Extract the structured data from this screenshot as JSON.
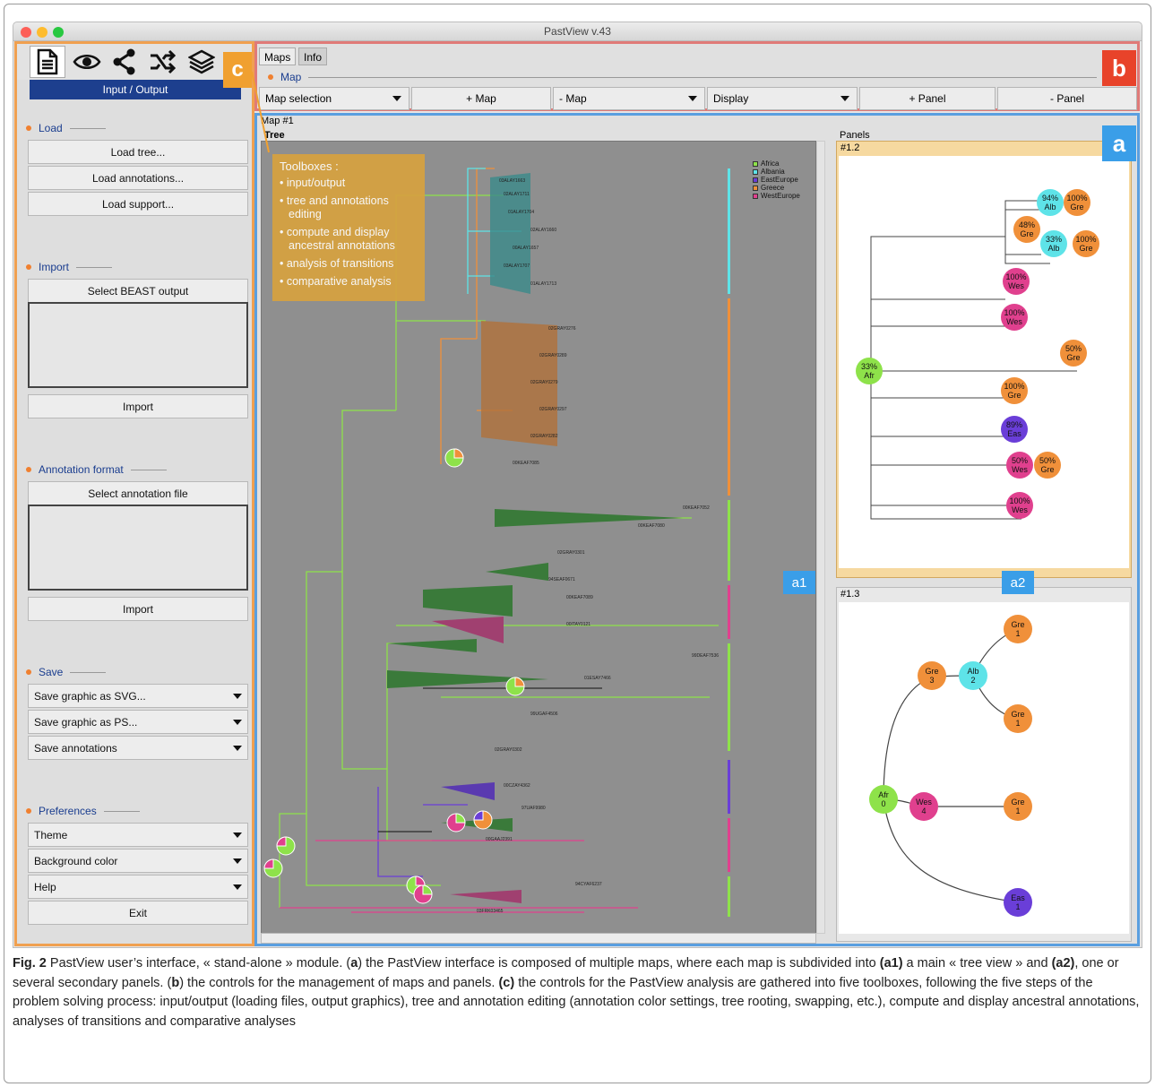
{
  "window": {
    "title": "PastView v.43"
  },
  "left_toolbox": {
    "header": "Input / Output",
    "icons": [
      "document-icon",
      "eye-icon",
      "share-icon",
      "shuffle-icon",
      "layers-icon"
    ],
    "load": {
      "title": "Load",
      "buttons": [
        "Load tree...",
        "Load annotations...",
        "Load support..."
      ]
    },
    "import": {
      "title": "Import",
      "label": "Select BEAST output",
      "button": "Import"
    },
    "annotation_format": {
      "title": "Annotation format",
      "label": "Select annotation file",
      "button": "Import"
    },
    "save": {
      "title": "Save",
      "items": [
        "Save graphic as SVG...",
        "Save graphic as PS...",
        "Save annotations"
      ]
    },
    "preferences": {
      "title": "Preferences",
      "items": [
        "Theme",
        "Background color",
        "Help"
      ],
      "exit": "Exit"
    }
  },
  "maps_toolbar": {
    "tabs": [
      "Maps",
      "Info"
    ],
    "section": "Map",
    "buttons": [
      "Map selection",
      "+ Map",
      "- Map",
      "Display",
      "+ Panel",
      "- Panel"
    ]
  },
  "map": {
    "title": "Map #1",
    "tree_label": "Tree",
    "panels_label": "Panels",
    "panel1": "#1.2",
    "panel2": "#1.3"
  },
  "callout": {
    "title": "Toolboxes :",
    "items": [
      "input/output",
      "tree and annotations editing",
      "compute and display ancestral annotations",
      "analysis of transitions",
      "comparative analysis"
    ]
  },
  "legend": [
    {
      "label": "Africa",
      "color": "#8ee24a"
    },
    {
      "label": "Albania",
      "color": "#5ee3e8"
    },
    {
      "label": "EastEurope",
      "color": "#6a3ed8"
    },
    {
      "label": "Greece",
      "color": "#f0903a"
    },
    {
      "label": "WestEurope",
      "color": "#e0408e"
    }
  ],
  "badges": {
    "a": "a",
    "b": "b",
    "c": "c",
    "a1": "a1",
    "a2": "a2"
  },
  "panel1_nodes": [
    {
      "pct": "94%",
      "name": "Alb",
      "color": "#5ee3e8"
    },
    {
      "pct": "100%",
      "name": "Gre",
      "color": "#f0903a"
    },
    {
      "pct": "48%",
      "name": "Gre",
      "color": "#f0903a"
    },
    {
      "pct": "33%",
      "name": "Alb",
      "color": "#5ee3e8"
    },
    {
      "pct": "100%",
      "name": "Gre",
      "color": "#f0903a"
    },
    {
      "pct": "100%",
      "name": "Wes",
      "color": "#e0408e"
    },
    {
      "pct": "100%",
      "name": "Wes",
      "color": "#e0408e"
    },
    {
      "pct": "50%",
      "name": "Gre",
      "color": "#f0903a"
    },
    {
      "pct": "33%",
      "name": "Afr",
      "color": "#8ee24a"
    },
    {
      "pct": "100%",
      "name": "Gre",
      "color": "#f0903a"
    },
    {
      "pct": "89%",
      "name": "Eas",
      "color": "#6a3ed8"
    },
    {
      "pct": "50%",
      "name": "Gre",
      "color": "#f0903a"
    },
    {
      "pct": "50%",
      "name": "Wes",
      "color": "#e0408e"
    },
    {
      "pct": "100%",
      "name": "Wes",
      "color": "#e0408e"
    }
  ],
  "panel2_nodes": [
    {
      "name": "Gre",
      "count": "1",
      "color": "#f0903a"
    },
    {
      "name": "Gre",
      "count": "3",
      "color": "#f0903a"
    },
    {
      "name": "Alb",
      "count": "2",
      "color": "#5ee3e8"
    },
    {
      "name": "Gre",
      "count": "1",
      "color": "#f0903a"
    },
    {
      "name": "Afr",
      "count": "0",
      "color": "#8ee24a"
    },
    {
      "name": "Wes",
      "count": "4",
      "color": "#e0408e"
    },
    {
      "name": "Gre",
      "count": "1",
      "color": "#f0903a"
    },
    {
      "name": "Eas",
      "count": "1",
      "color": "#6a3ed8"
    }
  ],
  "caption": {
    "fig": "Fig. 2",
    "p1": " PastView user’s interface, « stand-alone » module. (",
    "a": "a",
    "p2": ") the PastView interface is composed of multiple maps, where each map is subdivided into ",
    "a1": "(a1)",
    "p3": " a main « tree view » and ",
    "a2": "(a2)",
    "p4": ", one or several secondary panels. (",
    "b": "b",
    "p5": ") the controls for the management of maps and panels. ",
    "c": "(c)",
    "p6": " the controls for the PastView analysis are gathered into five toolboxes, following the five steps of the problem solving process: input/output (loading files, output graphics), tree and annotation editing (annotation color settings, tree rooting, swapping, etc.), compute and display ancestral annotations, analyses of transitions and comparative analyses"
  }
}
